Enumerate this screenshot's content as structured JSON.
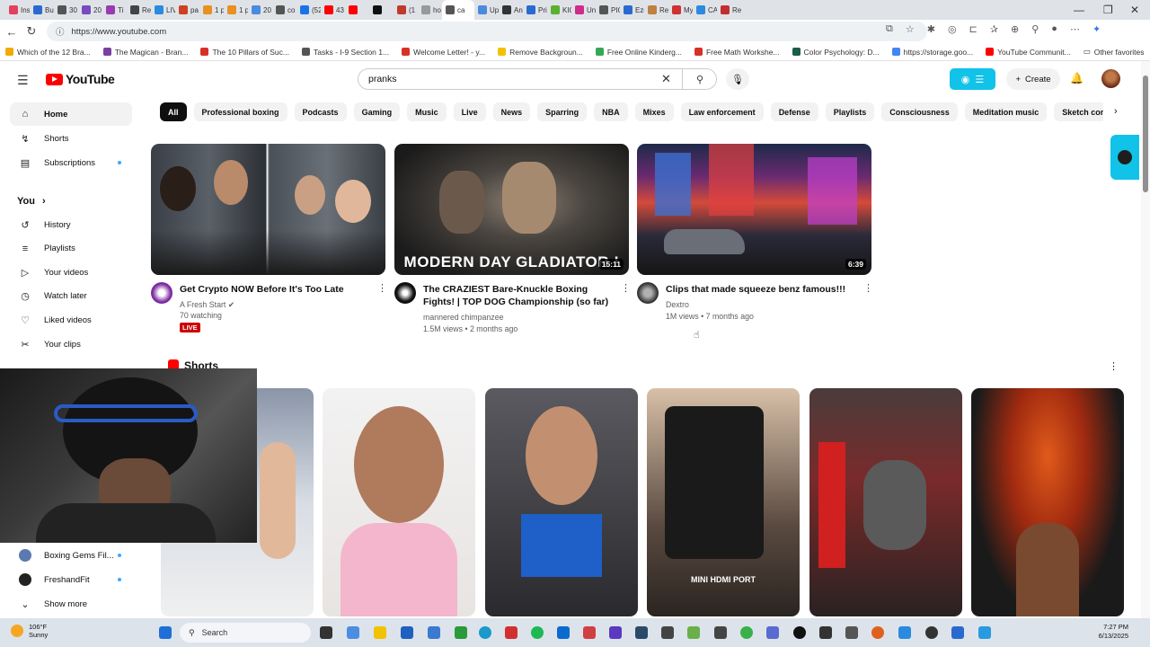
{
  "browser": {
    "url": "https://www.youtube.com",
    "tabs": [
      "Ins",
      "Bu",
      "30",
      "20",
      "Ti",
      "Re",
      "LIV",
      "pa",
      "1 p",
      "1 p",
      "20",
      "co",
      "(52",
      "43",
      "",
      "",
      "(1",
      "ho",
      "ca",
      "Up",
      "An",
      "Pri",
      "KIC",
      "Un",
      "PIC",
      "Ezo",
      "Re",
      "My",
      "CA",
      "Re"
    ],
    "bookmarks": [
      {
        "label": "Which of the 12 Bra...",
        "color": "#f2a900"
      },
      {
        "label": "The Magican - Bran...",
        "color": "#7b3fa0"
      },
      {
        "label": "The 10 Pillars of Suc...",
        "color": "#d93025"
      },
      {
        "label": "Tasks - I-9 Section 1...",
        "color": "#555555"
      },
      {
        "label": "Welcome Letter! - y...",
        "color": "#d93025"
      },
      {
        "label": "Remove Backgroun...",
        "color": "#f2c200"
      },
      {
        "label": "Free Online Kinderg...",
        "color": "#34a853"
      },
      {
        "label": "Free Math Workshe...",
        "color": "#d93025"
      },
      {
        "label": "Color Psychology: D...",
        "color": "#1a5c4a"
      },
      {
        "label": "https://storage.goo...",
        "color": "#4285f4"
      },
      {
        "label": "YouTube Communit...",
        "color": "#ff0000"
      }
    ],
    "other_favorites": "Other favorites"
  },
  "header": {
    "logo_text": "YouTube",
    "search_value": "pranks",
    "create_label": "Create"
  },
  "sidebar": {
    "items": [
      {
        "label": "Home",
        "icon": "home-icon",
        "glyph": "⌂"
      },
      {
        "label": "Shorts",
        "icon": "shorts-icon",
        "glyph": "↯"
      },
      {
        "label": "Subscriptions",
        "icon": "subscriptions-icon",
        "glyph": "▤"
      }
    ],
    "you_label": "You",
    "you_items": [
      {
        "label": "History",
        "icon": "history-icon",
        "glyph": "↺"
      },
      {
        "label": "Playlists",
        "icon": "playlists-icon",
        "glyph": "≡"
      },
      {
        "label": "Your videos",
        "icon": "your-videos-icon",
        "glyph": "▷"
      },
      {
        "label": "Watch later",
        "icon": "watch-later-icon",
        "glyph": "◷"
      },
      {
        "label": "Liked videos",
        "icon": "liked-videos-icon",
        "glyph": "♡"
      },
      {
        "label": "Your clips",
        "icon": "clips-icon",
        "glyph": "✂"
      }
    ],
    "subs": [
      {
        "label": "Boxing Gems Fil...",
        "color": "#5a7ab0"
      },
      {
        "label": "FreshandFit",
        "color": "#222222"
      }
    ],
    "show_more": "Show more"
  },
  "chips": [
    "All",
    "Professional boxing",
    "Podcasts",
    "Gaming",
    "Music",
    "Live",
    "News",
    "Sparring",
    "NBA",
    "Mixes",
    "Law enforcement",
    "Defense",
    "Playlists",
    "Consciousness",
    "Meditation music",
    "Sketch comedy"
  ],
  "videos": [
    {
      "title": "Get Crypto NOW Before It's Too Late",
      "channel": "A Fresh Start",
      "stats": "70 watching",
      "live": "LIVE",
      "duration": "",
      "caption": ""
    },
    {
      "title": "The CRAZIEST Bare-Knuckle Boxing Fights! | TOP DOG Championship (so far)",
      "channel": "mannered chimpanzee",
      "stats": "1.5M views • 2 months ago",
      "live": "",
      "duration": "15:11",
      "caption": "MODERN DAY GLADIATOR !"
    },
    {
      "title": "Clips that made squeeze benz famous!!!",
      "channel": "Dextro",
      "stats": "1M views • 7 months ago",
      "live": "",
      "duration": "6:39",
      "caption": ""
    }
  ],
  "shorts": {
    "title": "Shorts",
    "captions": [
      "",
      "",
      "",
      "MINI HDMI PORT",
      "",
      ""
    ]
  },
  "taskbar": {
    "temp": "106°F",
    "condition": "Sunny",
    "search_placeholder": "Search",
    "time": "7:27 PM",
    "date": "6/13/2025"
  }
}
